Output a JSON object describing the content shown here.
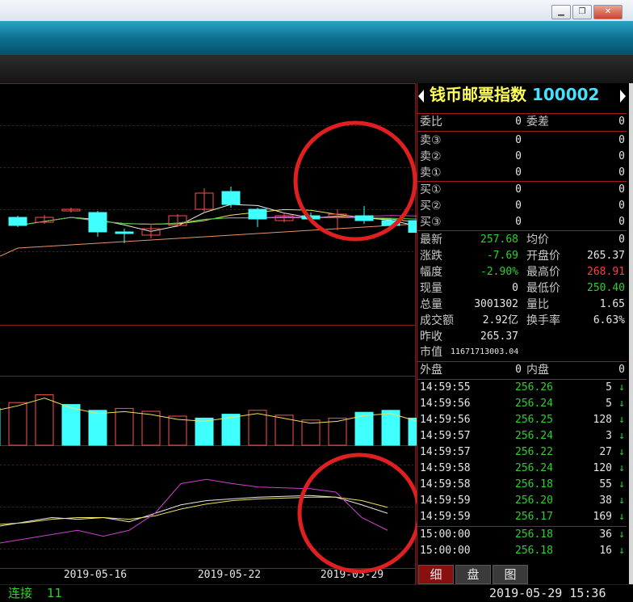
{
  "window": {
    "min_label": "▁",
    "max_label": "❐",
    "close_label": "✕"
  },
  "quote": {
    "name": "钱币邮票指数",
    "code": "100002",
    "weibi_label": "委比",
    "weibi_value": "0",
    "weicha_label": "委差",
    "weicha_value": "0",
    "sell": [
      {
        "label": "卖③",
        "value": "0",
        "value2": "0"
      },
      {
        "label": "卖②",
        "value": "0",
        "value2": "0"
      },
      {
        "label": "卖①",
        "value": "0",
        "value2": "0"
      }
    ],
    "buy": [
      {
        "label": "买①",
        "value": "0",
        "value2": "0"
      },
      {
        "label": "买②",
        "value": "0",
        "value2": "0"
      },
      {
        "label": "买③",
        "value": "0",
        "value2": "0"
      }
    ],
    "stats_left": [
      {
        "label": "最新",
        "value": "257.68",
        "color": "#2fd02f"
      },
      {
        "label": "涨跌",
        "value": "-7.69",
        "color": "#2fd02f"
      },
      {
        "label": "幅度",
        "value": "-2.90%",
        "color": "#2fd02f"
      },
      {
        "label": "现量",
        "value": "0",
        "color": "#e6e6e6"
      },
      {
        "label": "总量",
        "value": "3001302",
        "color": "#e6e6e6"
      },
      {
        "label": "成交额",
        "value": "2.92亿",
        "color": "#e6e6e6"
      },
      {
        "label": "昨收",
        "value": "265.37",
        "color": "#e6e6e6"
      }
    ],
    "stats_right": [
      {
        "label": "均价",
        "value": "0",
        "color": "#e6e6e6"
      },
      {
        "label": "开盘价",
        "value": "265.37",
        "color": "#e6e6e6"
      },
      {
        "label": "最高价",
        "value": "268.91",
        "color": "#ff4040"
      },
      {
        "label": "最低价",
        "value": "250.40",
        "color": "#2fd02f"
      },
      {
        "label": "量比",
        "value": "1.65",
        "color": "#e6e6e6"
      },
      {
        "label": "换手率",
        "value": "6.63%",
        "color": "#e6e6e6"
      }
    ],
    "market_cap_label": "市值",
    "market_cap_value": "11671713003.04",
    "outer_label": "外盘",
    "outer_value": "0",
    "inner_label": "内盘",
    "inner_value": "0"
  },
  "ticks": [
    {
      "time": "14:59:55",
      "price": "256.26",
      "vol": "5",
      "dir": "↓"
    },
    {
      "time": "14:59:56",
      "price": "256.24",
      "vol": "5",
      "dir": "↓"
    },
    {
      "time": "14:59:56",
      "price": "256.25",
      "vol": "128",
      "dir": "↓"
    },
    {
      "time": "14:59:57",
      "price": "256.24",
      "vol": "3",
      "dir": "↓"
    },
    {
      "time": "14:59:57",
      "price": "256.22",
      "vol": "27",
      "dir": "↓"
    },
    {
      "time": "14:59:58",
      "price": "256.24",
      "vol": "120",
      "dir": "↓"
    },
    {
      "time": "14:59:58",
      "price": "256.18",
      "vol": "55",
      "dir": "↓"
    },
    {
      "time": "14:59:59",
      "price": "256.20",
      "vol": "38",
      "dir": "↓"
    },
    {
      "time": "14:59:59",
      "price": "256.17",
      "vol": "169",
      "dir": "↓"
    },
    {
      "time": "15:00:00",
      "price": "256.18",
      "vol": "36",
      "dir": "↓"
    },
    {
      "time": "15:00:00",
      "price": "256.18",
      "vol": "16",
      "dir": "↓"
    }
  ],
  "tabs": [
    {
      "label": "细",
      "active": true
    },
    {
      "label": "盘",
      "active": false
    },
    {
      "label": "图",
      "active": false
    }
  ],
  "status": {
    "conn_label": "连接",
    "conn_value": "11",
    "datetime": "2019-05-29 15:36"
  },
  "chart_data": {
    "type": "candlestick",
    "x_tick_labels": [
      "2019-05-16",
      "2019-05-22",
      "2019-05-29"
    ],
    "candles": [
      {
        "open": 267.0,
        "close": 262.0,
        "high": 268.0,
        "low": 261.0
      },
      {
        "open": 264.0,
        "close": 267.0,
        "high": 268.5,
        "low": 263.0
      },
      {
        "open": 271.0,
        "close": 272.0,
        "high": 273.0,
        "low": 270.0
      },
      {
        "open": 270.0,
        "close": 258.0,
        "high": 271.0,
        "low": 255.0
      },
      {
        "open": 258.0,
        "close": 257.0,
        "high": 260.0,
        "low": 251.0
      },
      {
        "open": 256.0,
        "close": 260.0,
        "high": 262.0,
        "low": 254.0
      },
      {
        "open": 262.0,
        "close": 268.0,
        "high": 269.0,
        "low": 261.0
      },
      {
        "open": 272.0,
        "close": 282.0,
        "high": 285.0,
        "low": 270.0
      },
      {
        "open": 283.0,
        "close": 275.0,
        "high": 286.0,
        "low": 273.0
      },
      {
        "open": 272.0,
        "close": 266.0,
        "high": 273.0,
        "low": 261.0
      },
      {
        "open": 265.0,
        "close": 268.0,
        "high": 270.0,
        "low": 264.0
      },
      {
        "open": 268.0,
        "close": 266.0,
        "high": 270.0,
        "low": 264.0
      },
      {
        "open": 267.0,
        "close": 269.0,
        "high": 272.0,
        "low": 259.0
      },
      {
        "open": 268.0,
        "close": 265.0,
        "high": 274.0,
        "low": 263.0
      },
      {
        "open": 265.0,
        "close": 262.0,
        "high": 266.0,
        "low": 260.0
      },
      {
        "open": 265.0,
        "close": 257.7,
        "high": 268.9,
        "low": 250.4
      }
    ],
    "volume": [
      38,
      44,
      52,
      42,
      36,
      38,
      35,
      30,
      28,
      32,
      36,
      31,
      26,
      28,
      34,
      36,
      28
    ],
    "volume_up": [
      false,
      true,
      true,
      false,
      false,
      true,
      true,
      true,
      false,
      false,
      true,
      true,
      true,
      true,
      false,
      false,
      false
    ],
    "ma_long": [
      248,
      249,
      250,
      251,
      252,
      253,
      254,
      255,
      256,
      257,
      258,
      259,
      260,
      261,
      262,
      263
    ],
    "kdj_k": [
      40,
      45,
      50,
      48,
      50,
      45,
      55,
      65,
      70,
      72,
      74,
      75,
      76,
      74,
      65,
      55
    ],
    "kdj_d": [
      42,
      44,
      48,
      50,
      50,
      48,
      52,
      60,
      66,
      70,
      72,
      73,
      74,
      74,
      70,
      62
    ],
    "kdj_j": [
      20,
      25,
      30,
      35,
      28,
      35,
      55,
      90,
      95,
      90,
      86,
      85,
      84,
      80,
      50,
      35
    ]
  }
}
